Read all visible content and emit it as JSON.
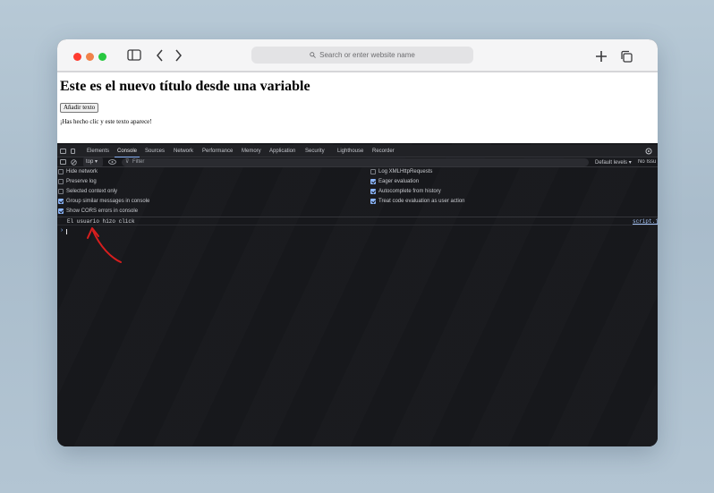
{
  "browser": {
    "url_placeholder": "Search or enter website name",
    "traffic_lights": {
      "close": "#ff5f57",
      "minimize": "#febc2e",
      "zoom": "#28c840"
    }
  },
  "page": {
    "title": "Este es el nuevo título desde una variable",
    "button_label": "Añadir texto",
    "paragraph": "¡Has hecho clic y este texto aparece!"
  },
  "devtools": {
    "tabs": [
      "Elements",
      "Console",
      "Sources",
      "Network",
      "Performance",
      "Memory",
      "Application",
      "Security",
      "Lighthouse",
      "Recorder"
    ],
    "active_tab": "Console",
    "context": "top",
    "filter_placeholder": "Filter",
    "levels": "Default levels",
    "issues": "No Issu",
    "settings_left": [
      {
        "label": "Hide network",
        "checked": false
      },
      {
        "label": "Preserve log",
        "checked": false
      },
      {
        "label": "Selected context only",
        "checked": false
      },
      {
        "label": "Group similar messages in console",
        "checked": true
      },
      {
        "label": "Show CORS errors in console",
        "checked": true
      }
    ],
    "settings_right": [
      {
        "label": "Log XMLHttpRequests",
        "checked": false
      },
      {
        "label": "Eager evaluation",
        "checked": true
      },
      {
        "label": "Autocomplete from history",
        "checked": true
      },
      {
        "label": "Treat code evaluation as user action",
        "checked": true
      }
    ],
    "console_message": "El usuario hizo click",
    "console_source": "script.js",
    "prompt": "›"
  },
  "annotation_color": "#d81e1e"
}
